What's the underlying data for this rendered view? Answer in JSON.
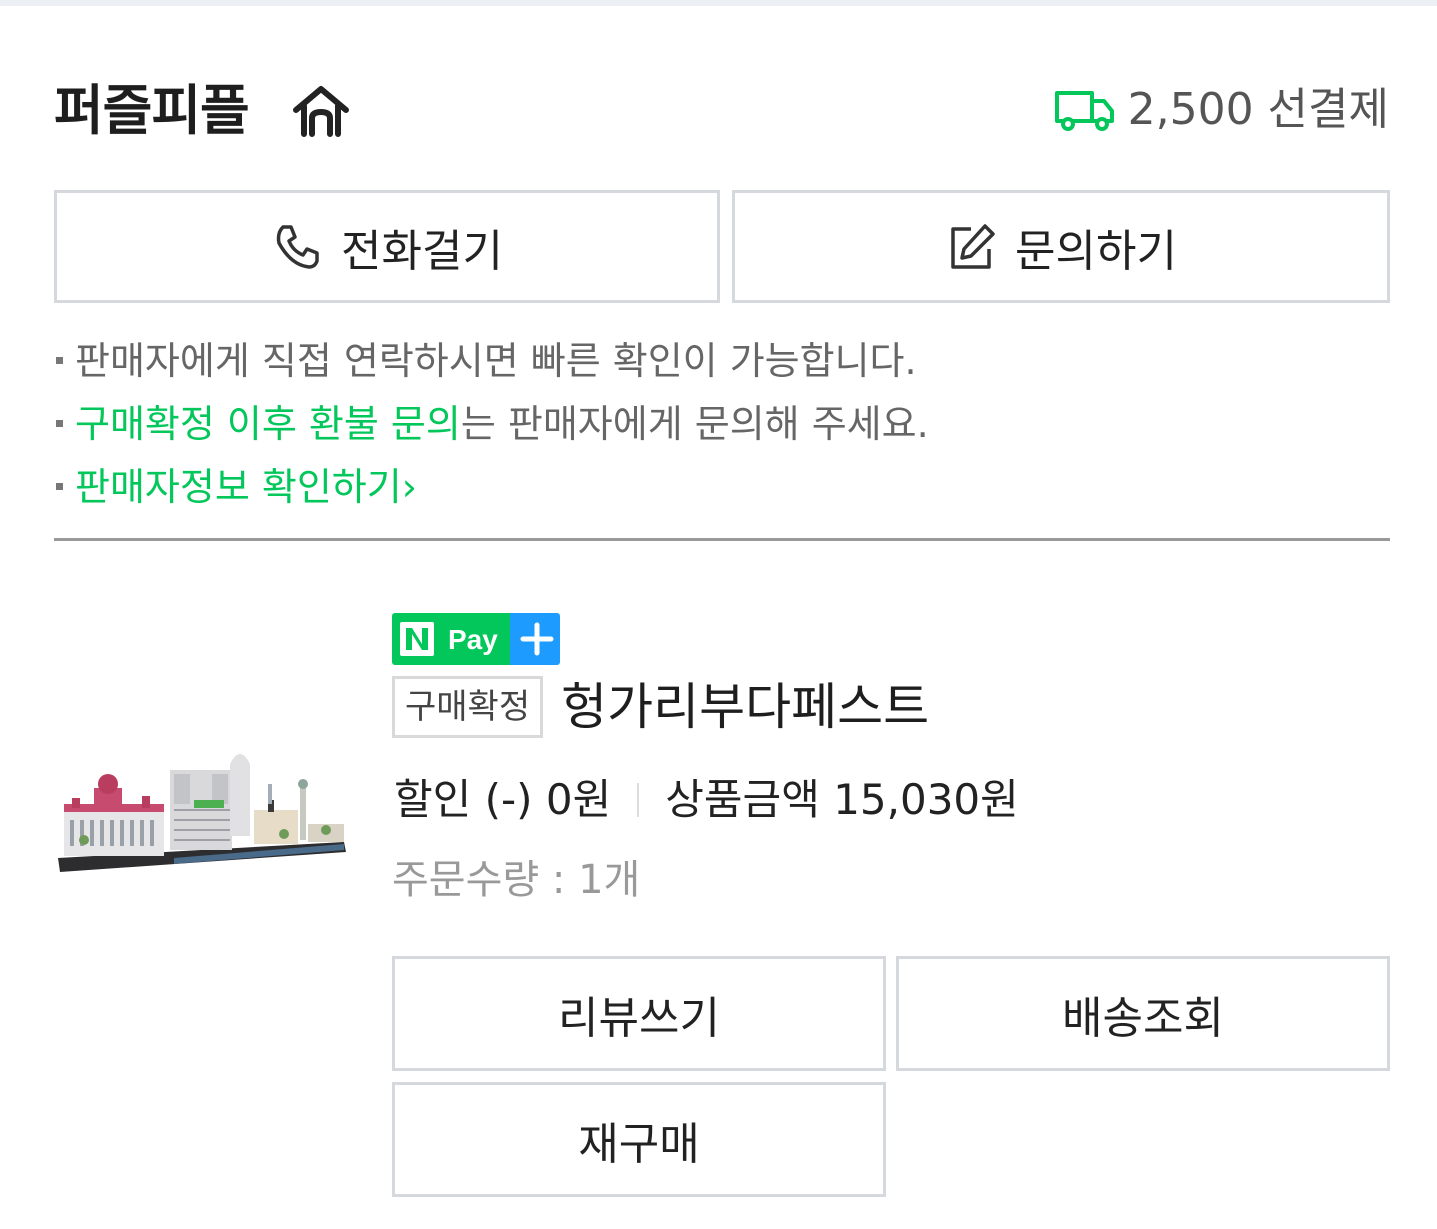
{
  "store": {
    "name": "퍼즐피플",
    "shipping_fee": "2,500 선결제"
  },
  "contact": {
    "call_label": "전화걸기",
    "inquiry_label": "문의하기"
  },
  "notes": {
    "line1": "판매자에게 직접 연락하시면 빠른 확인이 가능합니다.",
    "line2_highlight": "구매확정 이후 환불 문의",
    "line2_rest": "는 판매자에게 문의해 주세요.",
    "line3_link": "판매자정보 확인하기",
    "line3_chevron": "›"
  },
  "product": {
    "badge": "N Pay +",
    "status": "구매확정",
    "title": "헝가리부다페스트",
    "discount": "할인 (-) 0원",
    "price": "상품금액 15,030원",
    "quantity": "주문수량 : 1개"
  },
  "actions": {
    "review_label": "리뷰쓰기",
    "track_label": "배송조회",
    "rebuy_label": "재구매"
  },
  "colors": {
    "accent_green": "#03c75a",
    "npay_blue": "#1e9bff",
    "border": "#d5d8dc"
  },
  "icons": [
    "home-icon",
    "truck-icon",
    "phone-icon",
    "edit-icon",
    "chevron-right-icon"
  ]
}
